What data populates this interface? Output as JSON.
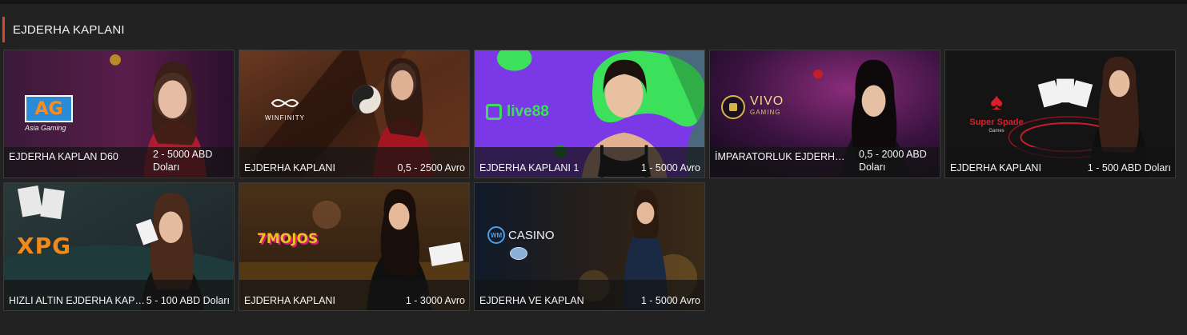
{
  "section": {
    "title": "EJDERHA KAPLANI"
  },
  "colors": {
    "accent": "#d44b2a",
    "background": "#222222",
    "card_border": "#3a3a3a"
  },
  "cards": [
    {
      "name": "EJDERHA KAPLAN D60",
      "limit": "2 - 5000 ABD Doları",
      "provider_logo": "AG",
      "provider_sub": "Asia Gaming"
    },
    {
      "name": "EJDERHA KAPLANI",
      "limit": "0,5 - 2500 Avro",
      "provider_logo": "WINFINITY",
      "provider_sub": ""
    },
    {
      "name": "EJDERHA KAPLANI 1",
      "limit": "1 - 5000 Avro",
      "provider_logo": "live88",
      "provider_sub": ""
    },
    {
      "name": "İMPARATORLUK EJDERHA ...",
      "limit": "0,5 - 2000 ABD Doları",
      "provider_logo": "VIVO",
      "provider_sub": "GAMING"
    },
    {
      "name": "EJDERHA KAPLANI",
      "limit": "1 - 500 ABD Doları",
      "provider_logo": "Super Spade",
      "provider_sub": "Games"
    },
    {
      "name": "HIZLI ALTIN EJDERHA KAPL...",
      "limit": "5 - 100 ABD Doları",
      "provider_logo": "XPG",
      "provider_sub": ""
    },
    {
      "name": "EJDERHA KAPLANI",
      "limit": "1 - 3000 Avro",
      "provider_logo": "7MOJOS",
      "provider_sub": ""
    },
    {
      "name": "EJDERHA VE KAPLAN",
      "limit": "1 - 5000 Avro",
      "provider_logo": "CASINO",
      "provider_sub": "WM"
    }
  ]
}
